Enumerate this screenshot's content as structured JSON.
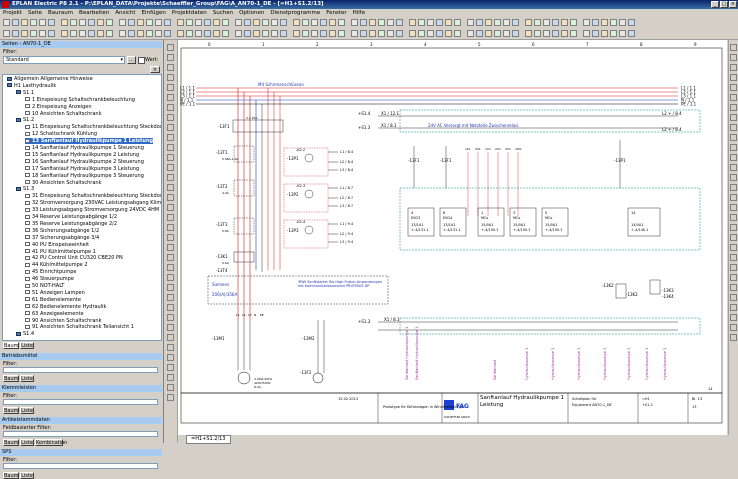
{
  "app": {
    "title": "EPLAN Electric P8 2.1 - P:\\EPLAN_DATA\\Projekte\\Schaeffler_Group\\FAG\\A_AN70-1_DE - [=H1+S1.2/13]",
    "window_buttons": [
      "_",
      "□",
      "×"
    ]
  },
  "menu": [
    "Projekt",
    "Seite",
    "Bauraum",
    "Bearbeiten",
    "Ansicht",
    "Einfügen",
    "Projektdaten",
    "Suchen",
    "Optionen",
    "Dienstprogramme",
    "Fenster",
    "Hilfe"
  ],
  "left_panel": {
    "pages_title": "Seiten - AN70-1_DE",
    "filter_label": "Filter:",
    "filter_value": "Standard",
    "filter_value_checkbox": "Wert:",
    "tree": [
      {
        "level": 0,
        "kind": "folder",
        "label": "Allgemein Allgemeine Hinweise"
      },
      {
        "level": 0,
        "kind": "folder",
        "label": "H1 Lasthydraulik"
      },
      {
        "level": 1,
        "kind": "folder",
        "label": "S1.1"
      },
      {
        "level": 2,
        "kind": "page",
        "label": "1 Einspeisung Schaltschrankbeleuchtung"
      },
      {
        "level": 2,
        "kind": "page",
        "label": "2 Einspeisung Anzeigen"
      },
      {
        "level": 2,
        "kind": "page",
        "label": "10 Ansichten Schaltschrank"
      },
      {
        "level": 1,
        "kind": "folder",
        "label": "S1.2"
      },
      {
        "level": 2,
        "kind": "page",
        "label": "11 Einspeisung Schaltschrankbeleuchtung Steckdoseanlage"
      },
      {
        "level": 2,
        "kind": "page",
        "label": "12 Schaltschrank Kühlung"
      },
      {
        "level": 2,
        "kind": "page",
        "label": "13 Sanftanlauf Hydraulikpumpe 1 Leistung",
        "bold": true
      },
      {
        "level": 2,
        "kind": "page",
        "label": "14 Sanftanlauf Hydraulikpumpe 1 Steuerung"
      },
      {
        "level": 2,
        "kind": "page",
        "label": "15 Sanftanlauf Hydraulikpumpe 2 Leistung"
      },
      {
        "level": 2,
        "kind": "page",
        "label": "16 Sanftanlauf Hydraulikpumpe 2 Steuerung"
      },
      {
        "level": 2,
        "kind": "page",
        "label": "17 Sanftanlauf Hydraulikpumpe 3 Leistung"
      },
      {
        "level": 2,
        "kind": "page",
        "label": "18 Sanftanlauf Hydraulikpumpe 3 Steuerung"
      },
      {
        "level": 2,
        "kind": "page",
        "label": "30 Ansichten Schaltschrank"
      },
      {
        "level": 1,
        "kind": "folder",
        "label": "S1.3"
      },
      {
        "level": 2,
        "kind": "page",
        "label": "31 Einspeisung Schaltschrankbeleuchtung Steckdoseanlage"
      },
      {
        "level": 2,
        "kind": "page",
        "label": "32 Stromversorgung 230VAC Leistungsabgang Klima 4HM"
      },
      {
        "level": 2,
        "kind": "page",
        "label": "33 Leistungsabgang Stromversorgung 24VDC 4HM"
      },
      {
        "level": 2,
        "kind": "page",
        "label": "34 Reserve Leistungsabgänge 1/2"
      },
      {
        "level": 2,
        "kind": "page",
        "label": "35 Reserve Leistungsabgänge 2/2"
      },
      {
        "level": 2,
        "kind": "page",
        "label": "36 Sicherungsabgänge 1/2"
      },
      {
        "level": 2,
        "kind": "page",
        "label": "37 Sicherungsabgänge 3/4"
      },
      {
        "level": 2,
        "kind": "page",
        "label": "40 PU Einspeiseeinheit"
      },
      {
        "level": 2,
        "kind": "page",
        "label": "41 PU Kühlmittelpumpe 1"
      },
      {
        "level": 2,
        "kind": "page",
        "label": "42 PU Control Unit CU320 CBE20 PN"
      },
      {
        "level": 2,
        "kind": "page",
        "label": "44 Kühlmittelpumpe 2"
      },
      {
        "level": 2,
        "kind": "page",
        "label": "45 Einrichtpumpe"
      },
      {
        "level": 2,
        "kind": "page",
        "label": "46 Steuerpumpe"
      },
      {
        "level": 2,
        "kind": "page",
        "label": "50 NOT-HALT"
      },
      {
        "level": 2,
        "kind": "page",
        "label": "51 Anzeigen Lampen"
      },
      {
        "level": 2,
        "kind": "page",
        "label": "61 Bedienelemente"
      },
      {
        "level": 2,
        "kind": "page",
        "label": "62 Bedienelemente Hydraulik"
      },
      {
        "level": 2,
        "kind": "page",
        "label": "63 Anzeigeelemente"
      },
      {
        "level": 2,
        "kind": "page",
        "label": "90 Ansichten Schaltschrank"
      },
      {
        "level": 2,
        "kind": "page",
        "label": "91 Ansichten Schaltschrank Teilansicht 1"
      },
      {
        "level": 1,
        "kind": "folder",
        "label": "S1.4"
      }
    ],
    "tree_tabs": [
      "Baum",
      "Liste"
    ],
    "panel2_title": "Betriebsmittel",
    "panel2_filter": "Filter:",
    "panel2_tabs": [
      "Baum",
      "Liste"
    ],
    "panel3_title": "Klemmleisten",
    "panel3_filter": "Filter:",
    "panel3_tabs": [
      "Baum",
      "Liste"
    ],
    "panel4_title": "Artikelstammdaten",
    "panel4_filter": "Feldbasierter Filter:",
    "panel4_tabs": [
      "Baum",
      "Liste",
      "Kombination"
    ],
    "panel5_title": "SPS",
    "panel5_filter": "Filter:",
    "panel5_tabs": [
      "Baum",
      "Liste"
    ]
  },
  "schematic": {
    "colors": {
      "wire_red": "#d11a1a",
      "wire_blue": "#1a3fd1",
      "wire_black": "#000000",
      "text_blue": "#2233aa",
      "purple": "#a020a0",
      "teal_box": "#009090",
      "highlight": "#00c000"
    },
    "supply_labels": [
      "L1 / 1.1",
      "L2 / 1.1",
      "L3 / 1.1",
      "N / 1.1",
      "PE / 1.1"
    ],
    "supply_targets": [
      "L1 / 1.1",
      "L2 / 1.1",
      "L3 / 1.1",
      "N / 1.1",
      "PE / 1.1"
    ],
    "supply_note": "Mit Schirmanschlüssen",
    "line_refs": [
      "+S1.4",
      "+S1.3"
    ],
    "x1_refs": [
      "X1 / 12.1",
      "X1 / 8.1",
      "L2 + / 8.4",
      "L2 + / 8.4"
    ],
    "note_24v": "24V AC Versorgt mit Netzteile Zwischenrelais",
    "breaker_labels": [
      "-13F1",
      "-13T1",
      "-13T2",
      "-13T3",
      "-13K1",
      "-13T4"
    ],
    "breaker_specs": [
      "3 x 25A",
      "0.98A-1.6A",
      "4.0A",
      "0.8A",
      "0.6A"
    ],
    "contactor_labels": [
      "-13P1",
      "-13P2",
      "-13P3"
    ],
    "contact_refs": [
      "-K2.2",
      "-K2.3",
      "-K2.4"
    ],
    "right_refs": [
      "L1 / 8.4",
      "L2 / 8.4",
      "L3 / 8.4",
      "L1 / 8.7",
      "L2 / 8.7",
      "L3 / 8.7",
      "L1 / 9.4",
      "L2 / 9.4",
      "L3 / 9.4"
    ],
    "softstarter_brand": "Siemens",
    "softstarter_value": "200(A)/356A",
    "softstarter_note": "3RW Sanftstarter Bis High Fusion Anwendungen mit Kommunikationsmodul PROFIBUS DP",
    "module_terminals": [
      "1S1",
      "3S1",
      "1V1",
      "2V1",
      "3V1",
      "1W1"
    ],
    "modules": [
      {
        "title": "4",
        "sub": "ESG3",
        "v1": "13/1A1",
        "v2": "+-4/131.1"
      },
      {
        "title": "6",
        "sub": "ESG4",
        "v1": "13/1A1",
        "v2": "+-4/131.1"
      },
      {
        "title": "1",
        "sub": "MCs",
        "v1": "15/0A1",
        "v2": "+-4/150.1"
      },
      {
        "title": "3",
        "sub": "MCs",
        "v1": "15/0A1",
        "v2": "+-4/150.1"
      },
      {
        "title": "5",
        "sub": "MCs",
        "v1": "15/0A1",
        "v2": "+-4/150.1"
      },
      {
        "title": "14",
        "sub": "",
        "v1": "14/0A1",
        "v2": "+-4/140.1"
      }
    ],
    "relay_labels": [
      "-13F1",
      "-13F1",
      "-13P1"
    ],
    "k_labels": [
      "-13K2",
      "-13K2",
      "-13K3",
      "-13K4"
    ],
    "motor_labels": [
      "-13M1",
      "-13M2",
      "-13F2"
    ],
    "motor_specs": [
      "4.0kW 50Hz",
      "400V/50Hz",
      "8.2A"
    ],
    "bottom_ref": "X1 / 8.1",
    "bottom_terminals": [
      "L1",
      "L2",
      "L3",
      "N",
      "PE"
    ],
    "vertical_labels": [
      "Sanftanlauf Hydraulikpumpe 1",
      "Sanftanlauf Hydraulikpumpe 1",
      "Sanftanlauf",
      "Hydraulikpumpe 1",
      "Hydraulikpumpe 1",
      "Hydraulikpumpe 1",
      "Hydraulikpumpe 1",
      "Hydraulikpumpe 1",
      "Hydraulikpumpe 1",
      "Hydraulikpumpe 1"
    ],
    "column_numbers": [
      "0",
      "1",
      "2",
      "3",
      "4",
      "5",
      "6",
      "7",
      "8",
      "9"
    ],
    "titleblock": {
      "project": "Prototype für Kühlanlagen in Windkraftanlagen",
      "description": "Sanftanlauf Hydraulikpumpe 1 Leistung",
      "company_left": "FAG",
      "company_sub": "SCHAEFFLER GROUP",
      "label1": "Schaltplan für",
      "label2": "Equipment AN70-1_DE",
      "date": "15.02.2013",
      "page": "13",
      "of": "14",
      "sheet_ref": "=H1",
      "location": "+S1.2",
      "rev": "Bl. 13"
    }
  },
  "page_tab": "=H1+S1.2/13"
}
